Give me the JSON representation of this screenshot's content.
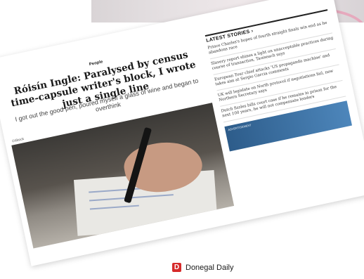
{
  "article": {
    "kicker": "People",
    "headline": "Róisín Ingle: Paralysed by census time-capsule writer's block, I wrote just a single line",
    "standfirst": "I got out the good pen, poured myself a glass of wine and began to overthink",
    "photo_credit": "©iStock"
  },
  "sidebar": {
    "heading": "LATEST STORIES ›",
    "stories": [
      "Prince Charles's hopes of fourth straight finals win end as he abandons race",
      "Slavery report shines a light on unacceptable practices during course of transaction, Taoiseach says",
      "European Tour chief attacks 'US propaganda machine' and takes aim at Sergio Garcia comments",
      "UK will legislate on North protocol if negotiations fail, new Northern Secretary says",
      "Dutch fizzles bills court case if he remains in prison for the next 100 years, he will not compensate lenders"
    ],
    "ad_label": "ADVERTISEMENT"
  },
  "footer": {
    "brand_initial": "D",
    "brand_name": "Donegal Daily"
  }
}
